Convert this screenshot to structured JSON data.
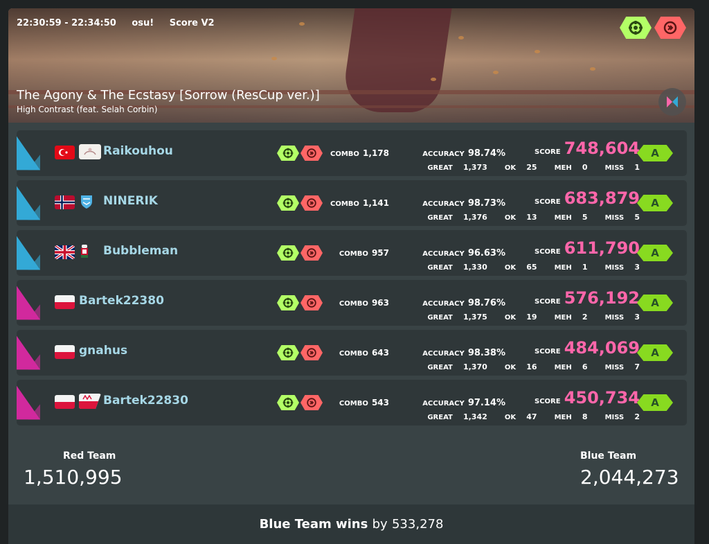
{
  "header": {
    "time_range": "22:30:59 - 22:34:50",
    "mode": "osu!",
    "scoring": "Score V2",
    "title": "The Agony & The Ecstasy [Sorrow (ResCup ver.)]",
    "artist": "High Contrast (feat. Selah Corbin)",
    "mods": [
      "nofail-icon",
      "hidden-icon"
    ]
  },
  "labels": {
    "combo": "COMBO",
    "accuracy": "ACCURACY",
    "score": "SCORE",
    "great": "GREAT",
    "ok": "OK",
    "meh": "MEH",
    "miss": "MISS"
  },
  "rows": [
    {
      "team": "blue",
      "name": "Raikouhou",
      "flag": "TR",
      "combo": "1,178",
      "accuracy": "98.74%",
      "score": "748,604",
      "great": "1,373",
      "ok": "25",
      "meh": "0",
      "miss": "1",
      "rank": "A"
    },
    {
      "team": "blue",
      "name": "NINERIK",
      "flag": "NO",
      "combo": "1,141",
      "accuracy": "98.73%",
      "score": "683,879",
      "great": "1,376",
      "ok": "13",
      "meh": "5",
      "miss": "5",
      "rank": "A"
    },
    {
      "team": "blue",
      "name": "Bubbleman",
      "flag": "GB",
      "combo": "957",
      "accuracy": "96.63%",
      "score": "611,790",
      "great": "1,330",
      "ok": "65",
      "meh": "1",
      "miss": "3",
      "rank": "A"
    },
    {
      "team": "red",
      "name": "Bartek22380",
      "flag": "PL",
      "combo": "963",
      "accuracy": "98.76%",
      "score": "576,192",
      "great": "1,375",
      "ok": "19",
      "meh": "2",
      "miss": "3",
      "rank": "A"
    },
    {
      "team": "red",
      "name": "gnahus",
      "flag": "PL",
      "combo": "643",
      "accuracy": "98.38%",
      "score": "484,069",
      "great": "1,370",
      "ok": "16",
      "meh": "6",
      "miss": "7",
      "rank": "A"
    },
    {
      "team": "red",
      "name": "Bartek22830",
      "flag": "PL",
      "combo": "543",
      "accuracy": "97.14%",
      "score": "450,734",
      "great": "1,342",
      "ok": "47",
      "meh": "8",
      "miss": "2",
      "rank": "A"
    }
  ],
  "totals": {
    "red_label": "Red Team",
    "red_score": "1,510,995",
    "blue_label": "Blue Team",
    "blue_score": "2,044,273"
  },
  "result": {
    "prefix": "Blue Team wins",
    "by": "by",
    "margin": "533,278"
  },
  "colors": {
    "blue_team": "#33a9d6",
    "red_team": "#d1299d",
    "score_pink": "#ff66aa",
    "rank_green": "#88da20",
    "name_blue": "#a6d7e6"
  }
}
